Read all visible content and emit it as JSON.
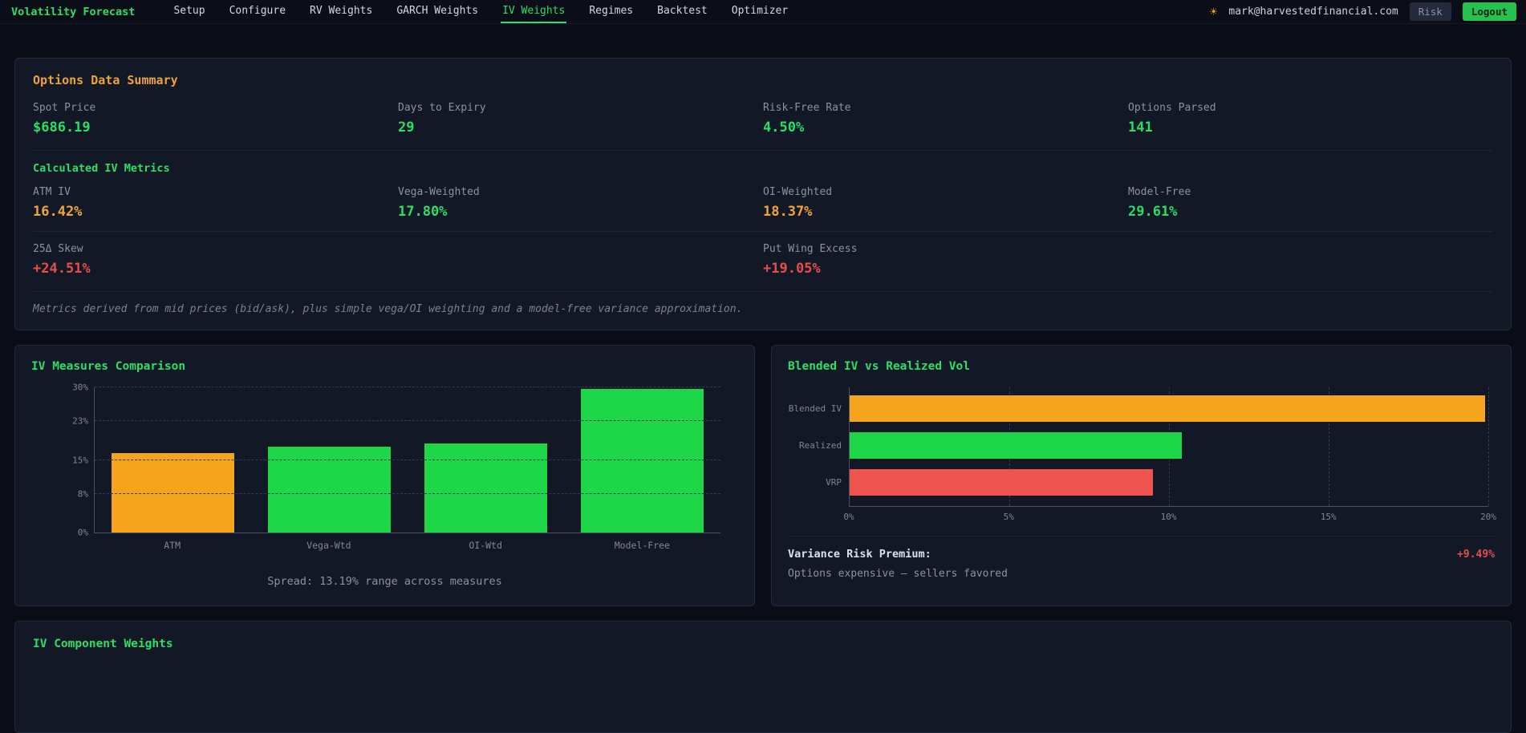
{
  "colors": {
    "green": "#2bdf64",
    "orange": "#f0a437",
    "red": "#e84c4c"
  },
  "navbar": {
    "brand": "Volatility Forecast",
    "items": [
      {
        "label": "Setup",
        "active": false
      },
      {
        "label": "Configure",
        "active": false
      },
      {
        "label": "RV Weights",
        "active": false
      },
      {
        "label": "GARCH Weights",
        "active": false
      },
      {
        "label": "IV Weights",
        "active": true
      },
      {
        "label": "Regimes",
        "active": false
      },
      {
        "label": "Backtest",
        "active": false
      },
      {
        "label": "Optimizer",
        "active": false
      }
    ],
    "theme_icon": "sun-icon",
    "user_email": "mark@harvestedfinancial.com",
    "risk_label": "Risk",
    "logout_label": "Logout"
  },
  "summary": {
    "title": "Options Data Summary",
    "stats": [
      {
        "label": "Spot Price",
        "value": "$686.19",
        "color": "#2bdf64"
      },
      {
        "label": "Days to Expiry",
        "value": "29",
        "color": "#2bdf64"
      },
      {
        "label": "Risk-Free Rate",
        "value": "4.50%",
        "color": "#2bdf64"
      },
      {
        "label": "Options Parsed",
        "value": "141",
        "color": "#2bdf64"
      }
    ],
    "metrics_title": "Calculated IV Metrics",
    "metrics": [
      {
        "label": "ATM IV",
        "value": "16.42%",
        "color": "#f0a437"
      },
      {
        "label": "Vega-Weighted",
        "value": "17.80%",
        "color": "#2bdf64"
      },
      {
        "label": "OI-Weighted",
        "value": "18.37%",
        "color": "#f0a437"
      },
      {
        "label": "Model-Free",
        "value": "29.61%",
        "color": "#2bdf64"
      }
    ],
    "skew_metrics": [
      {
        "label": "25Δ Skew",
        "value": "+24.51%",
        "color": "#e84c4c"
      },
      {
        "label": "Put Wing Excess",
        "value": "+19.05%",
        "color": "#e84c4c"
      }
    ],
    "footnote": "Metrics derived from mid prices (bid/ask), plus simple vega/OI weighting and a model-free variance approximation."
  },
  "iv_comparison": {
    "title": "IV Measures Comparison",
    "spread_note": "Spread: 13.19% range across measures",
    "chart_data": {
      "type": "bar",
      "categories": [
        "ATM",
        "Vega-Wtd",
        "OI-Wtd",
        "Model-Free"
      ],
      "values": [
        16.42,
        17.8,
        18.37,
        29.61
      ],
      "bar_colors": [
        "#f5a41d",
        "#1ed748",
        "#1ed748",
        "#1ed748"
      ],
      "ylim": [
        0,
        30
      ],
      "ytick_values": [
        0,
        8,
        15,
        23,
        30
      ],
      "ytick_labels": [
        "0%",
        "8%",
        "15%",
        "23%",
        "30%"
      ]
    }
  },
  "blended_vs_realized": {
    "title": "Blended IV vs Realized Vol",
    "chart_data": {
      "type": "bar_horizontal",
      "categories": [
        "Blended IV",
        "Realized",
        "VRP"
      ],
      "values": [
        19.9,
        10.4,
        9.49
      ],
      "bar_colors": [
        "#f5a41d",
        "#1ed748",
        "#ef5350"
      ],
      "xlim": [
        0,
        20
      ],
      "xtick_values": [
        0,
        5,
        10,
        15,
        20
      ],
      "xtick_labels": [
        "0%",
        "5%",
        "10%",
        "15%",
        "20%"
      ]
    },
    "vrp_label": "Variance Risk Premium:",
    "vrp_value": "+9.49%",
    "vrp_color": "#e84c4c",
    "note": "Options expensive — sellers favored"
  },
  "component_weights": {
    "title": "IV Component Weights"
  }
}
